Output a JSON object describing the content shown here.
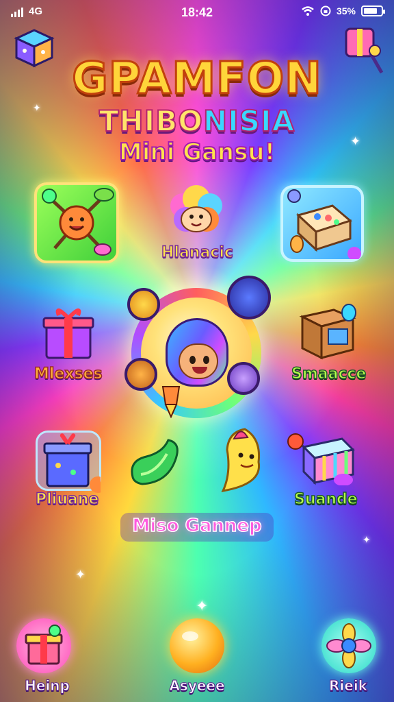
{
  "status_bar": {
    "time": "18:42",
    "carrier": "4G",
    "right_text": "35%",
    "battery_level": 0.8,
    "icons": [
      "signal-bars-icon",
      "wifi-icon",
      "lock-rotation-icon",
      "battery-icon"
    ]
  },
  "title": {
    "line1": "GPAMFON",
    "line2a": "THIBO",
    "line2b": "NISIA",
    "tagline": "Mini Gansu!"
  },
  "games": [
    {
      "label": "",
      "icon": "gadget-creature-icon"
    },
    {
      "label": "Hlanacic",
      "icon": "fluffy-creature-icon"
    },
    {
      "label": "",
      "icon": "puzzle-box-icon"
    },
    {
      "label": "Mlexses",
      "icon": "gift-box-icon"
    },
    {
      "label": "Smaacce",
      "icon": "treasure-crate-icon"
    },
    {
      "label": "Pliuane",
      "icon": "mystery-box-icon"
    },
    {
      "label": "",
      "icon": "green-bean-icon"
    },
    {
      "label": "",
      "icon": "yellow-creature-icon"
    },
    {
      "label": "Suande",
      "icon": "striped-cube-icon"
    }
  ],
  "center": {
    "icon": "robot-mascot-icon"
  },
  "banner": {
    "text": "Miso Gannep"
  },
  "bottom_nav": [
    {
      "label": "Heinp",
      "icon": "gift-icon"
    },
    {
      "label": "Asyeee",
      "icon": "orange-ball-icon"
    },
    {
      "label": "Rieik",
      "icon": "flower-gem-icon"
    }
  ],
  "colors": {
    "title_fill": "#ffd53a",
    "title_stroke": "#c2410c",
    "label_yellow": "#ffe54a",
    "label_green": "#b8ff4a",
    "banner_pink": "#ff5adf"
  }
}
